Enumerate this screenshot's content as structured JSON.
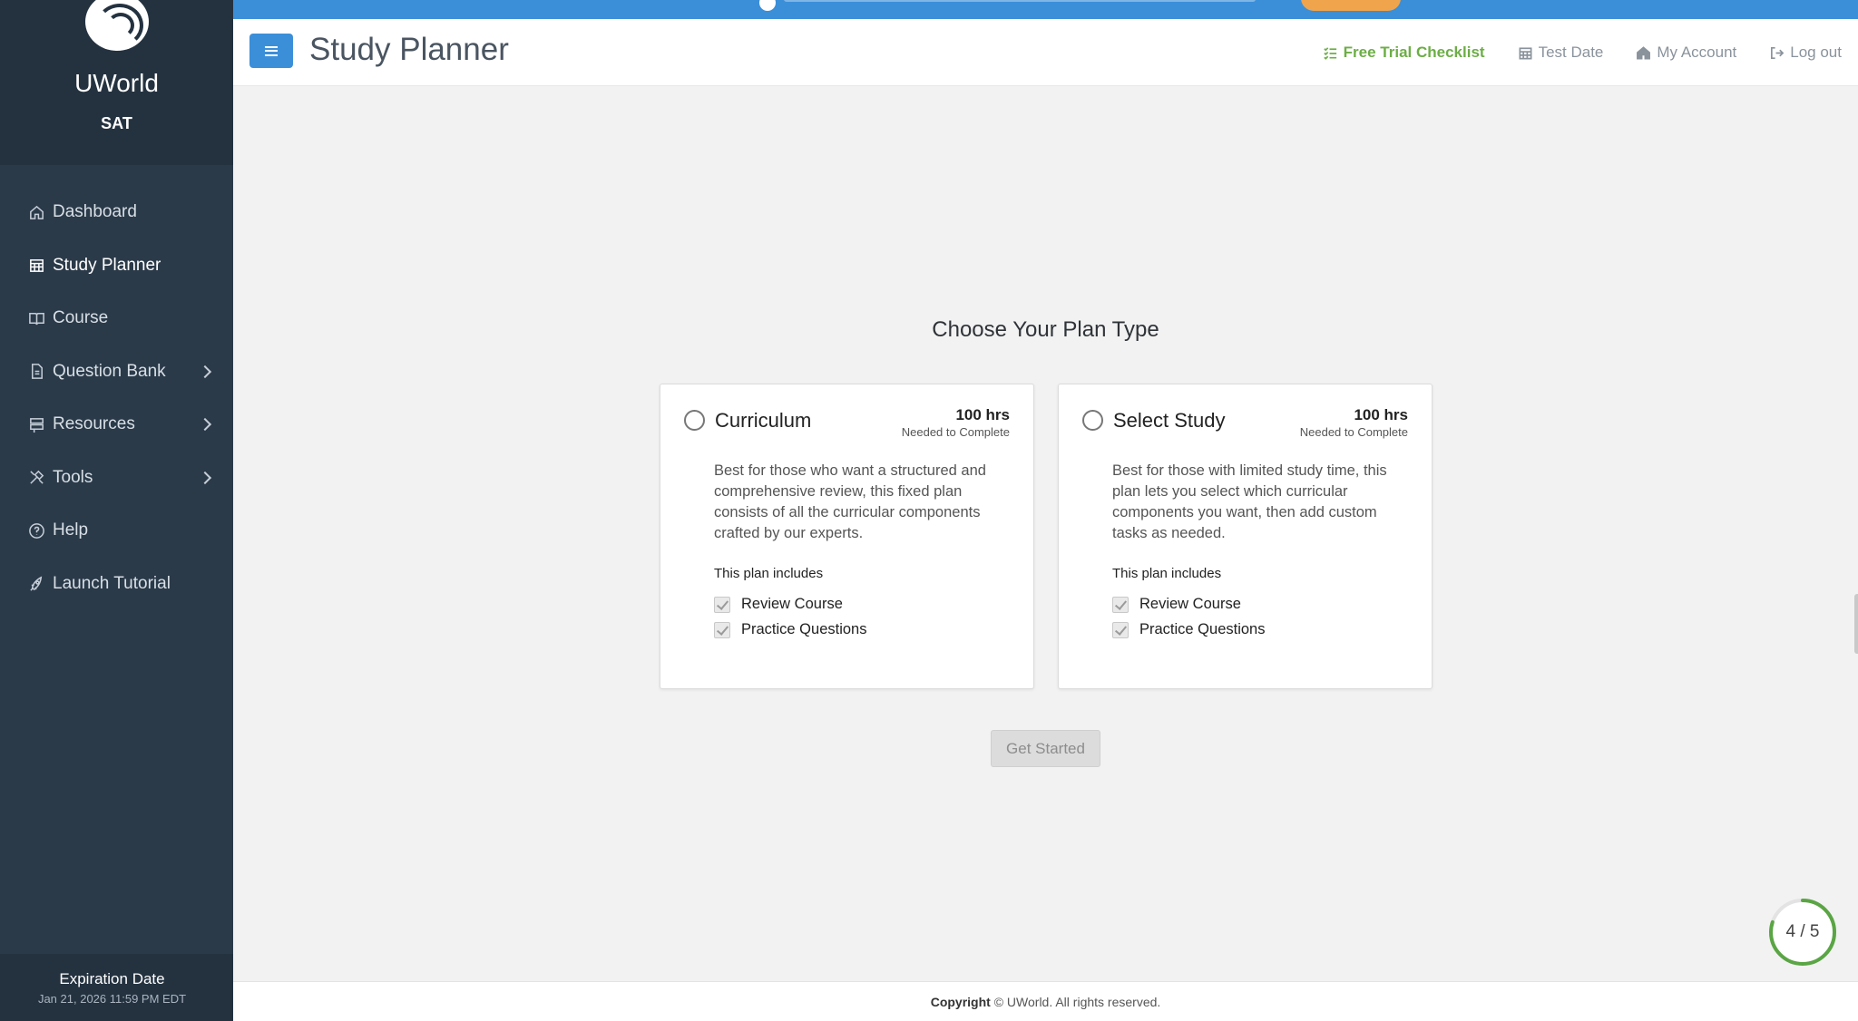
{
  "brand": {
    "name": "UWorld",
    "product": "SAT"
  },
  "sidebar": {
    "items": [
      {
        "label": "Dashboard"
      },
      {
        "label": "Study Planner"
      },
      {
        "label": "Course"
      },
      {
        "label": "Question Bank"
      },
      {
        "label": "Resources"
      },
      {
        "label": "Tools"
      },
      {
        "label": "Help"
      },
      {
        "label": "Launch Tutorial"
      }
    ],
    "expiration_label": "Expiration Date",
    "expiration_value": "Jan 21, 2026 11:59 PM EDT"
  },
  "header": {
    "title": "Study Planner",
    "links": {
      "free_trial": "Free Trial Checklist",
      "test_date": "Test Date",
      "my_account": "My Account",
      "log_out": "Log out"
    }
  },
  "main": {
    "title": "Choose Your Plan Type",
    "plans": [
      {
        "name": "Curriculum",
        "hours": "100 hrs",
        "needed": "Needed to Complete",
        "description": "Best for those who want a structured and comprehensive review, this fixed plan consists of all the curricular components crafted by our experts.",
        "includes_label": "This plan includes",
        "includes": [
          "Review Course",
          "Practice Questions"
        ]
      },
      {
        "name": "Select Study",
        "hours": "100 hrs",
        "needed": "Needed to Complete",
        "description": "Best for those with limited study time, this plan lets you select which curricular components you want, then add custom tasks as needed.",
        "includes_label": "This plan includes",
        "includes": [
          "Review Course",
          "Practice Questions"
        ]
      }
    ],
    "get_started": "Get Started"
  },
  "progress": {
    "text": "4 / 5",
    "fraction": 0.8,
    "color": "#5aa544"
  },
  "colors": {
    "accent": "#3b8fd9",
    "sidebar": "#2b3a49",
    "trial_link": "#6cae46"
  },
  "footer": {
    "bold": "Copyright",
    "text": "© UWorld. All rights reserved."
  }
}
